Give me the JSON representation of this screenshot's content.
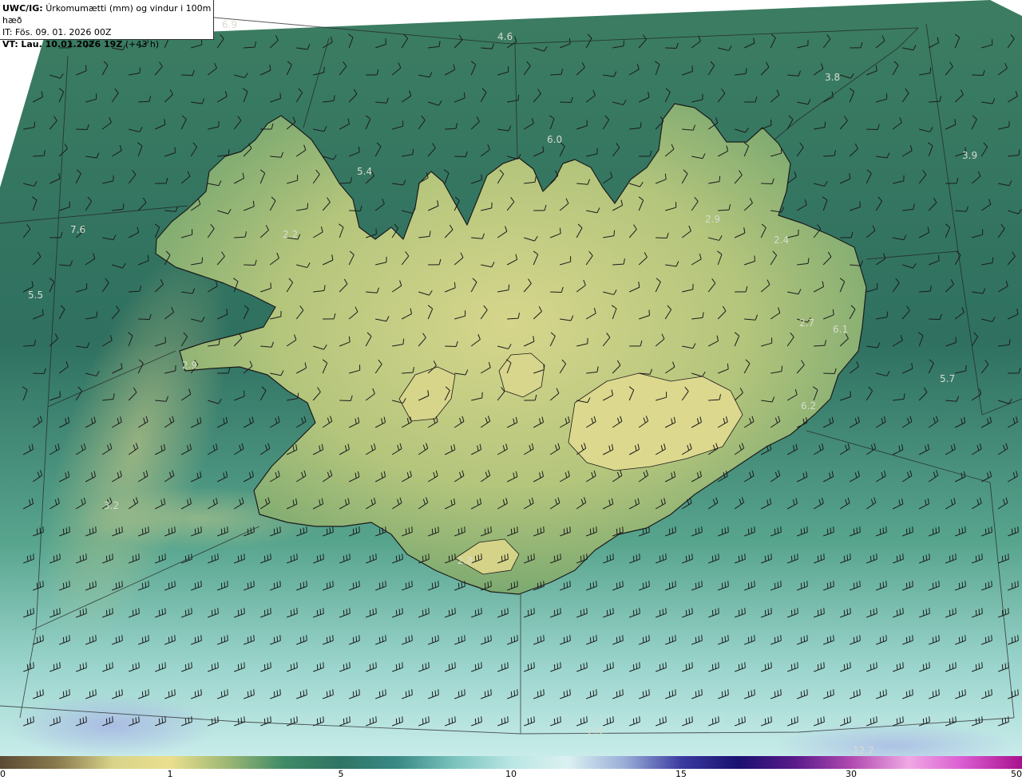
{
  "header": {
    "model": "UWC/IG:",
    "title": "Úrkomumætti (mm) og vindur i 100m hæð",
    "it_label": "IT:",
    "it_value": "Fös. 09. 01. 2026 00Z",
    "vt_label": "VT:",
    "vt_value": "Lau. 10.01.2026 19Z",
    "vt_offset": "(+43 h)"
  },
  "colorbar": {
    "ticks": [
      "0",
      "1",
      "5",
      "10",
      "15",
      "30",
      "50"
    ],
    "colors": [
      "#5b4a33",
      "#8a7a4e",
      "#d8d48a",
      "#eadf8e",
      "#9db874",
      "#3f8a66",
      "#2f7464",
      "#3a8a86",
      "#7ac2bd",
      "#b9e6e3",
      "#dbf1f1",
      "#9aaed8",
      "#3b3ba0",
      "#1a1070",
      "#5a1a8a",
      "#b04ab0",
      "#f0a8e4",
      "#d85ad0",
      "#a8108c"
    ]
  },
  "map_values": [
    "6.9",
    "4.6",
    "3.8",
    "3.9",
    "6.0",
    "5.4",
    "2.9",
    "2.4",
    "7.6",
    "2.2",
    "5.5",
    "2.7",
    "6.1",
    "5.7",
    "6.2",
    "2.9",
    "3.2",
    "2.8",
    "2.9",
    "12.2"
  ],
  "palette": {
    "ocean_dark": "#2e6e5c",
    "ocean_mid": "#3c8a72",
    "ocean_light": "#8fcfc8",
    "land_high": "#d2d38a",
    "land_mid": "#9cb86e",
    "coast": "#1b1b1b"
  }
}
